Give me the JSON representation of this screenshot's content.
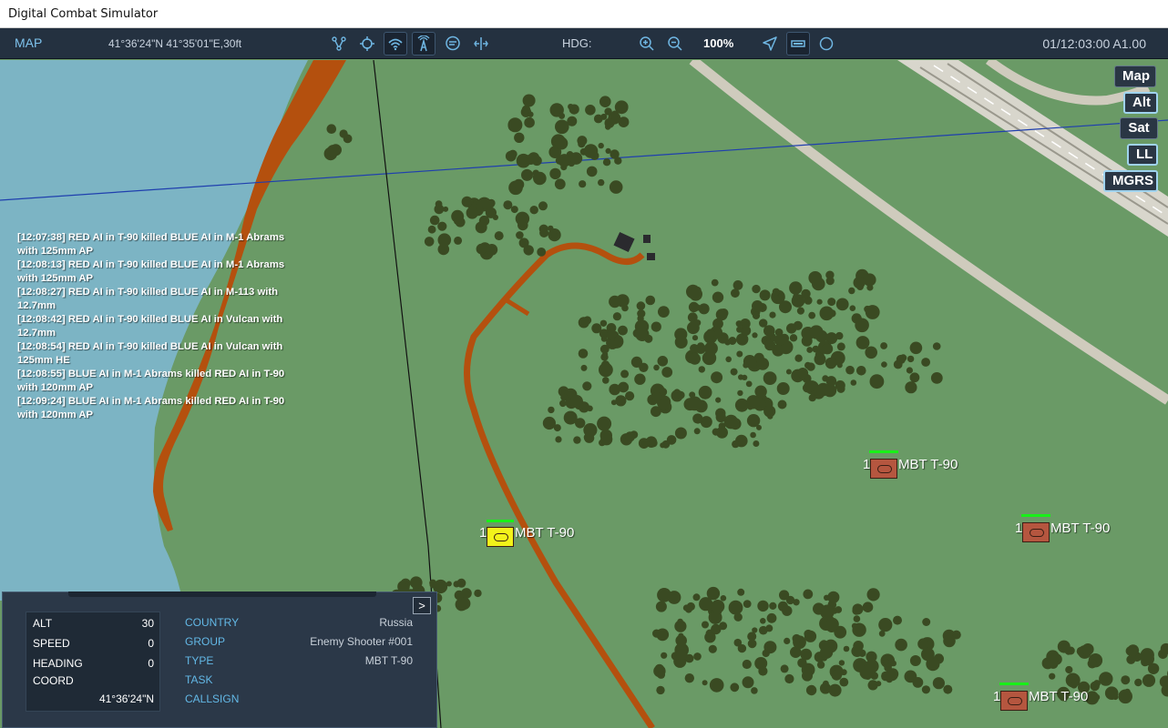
{
  "window": {
    "title": "Digital Combat Simulator"
  },
  "toolbar": {
    "map_label": "MAP",
    "coords": "41°36'24\"N 41°35'01\"E,30ft",
    "hdg_label": "HDG:",
    "zoom": "100%",
    "time": "01/12:03:00 A1.00",
    "icons": [
      "route-icon",
      "target-crosshair-icon",
      "wifi-icon",
      "radio-tower-icon",
      "chat-icon",
      "split-icon",
      "zoom-in-icon",
      "zoom-out-icon",
      "navigate-arrow-icon",
      "toggle-bar-icon",
      "circle-icon"
    ]
  },
  "map_buttons": {
    "map": "Map",
    "alt": "Alt",
    "sat": "Sat",
    "ll": "LL",
    "mgrs": "MGRS"
  },
  "log": [
    "[12:07:38] RED AI in T-90 killed BLUE AI in M-1 Abrams with 125mm AP",
    "[12:08:13] RED AI in T-90 killed BLUE AI in M-1 Abrams with 125mm AP",
    "[12:08:27] RED AI in T-90 killed BLUE AI in M-113 with 12.7mm",
    "[12:08:42] RED AI in T-90 killed BLUE AI in Vulcan with 12.7mm",
    "[12:08:54] RED AI in T-90 killed BLUE AI in Vulcan with 125mm HE",
    "[12:08:55] BLUE AI in M-1 Abrams killed RED AI in T-90 with 120mm AP",
    "[12:09:24] BLUE AI in M-1 Abrams killed RED AI in T-90 with 120mm AP"
  ],
  "units": [
    {
      "count": "1",
      "label": "MBT T-90",
      "selected": true,
      "health": 1.0
    },
    {
      "count": "1",
      "label": "MBT T-90",
      "selected": false,
      "health": 1.0
    },
    {
      "count": "1",
      "label": "MBT T-90",
      "selected": false,
      "health": 1.0
    },
    {
      "count": "1",
      "label": "MBT T-90",
      "selected": false,
      "health": 1.0
    }
  ],
  "panel": {
    "expand_label": ">",
    "stats": {
      "alt_label": "ALT",
      "alt": "30",
      "speed_label": "SPEED",
      "speed": "0",
      "heading_label": "HEADING",
      "heading": "0",
      "coord_label": "COORD",
      "coord": "41°36'24\"N"
    },
    "props": {
      "country_label": "COUNTRY",
      "country": "Russia",
      "group_label": "GROUP",
      "group": "Enemy Shooter #001",
      "type_label": "TYPE",
      "type": "MBT T-90",
      "task_label": "TASK",
      "task": "",
      "callsign_label": "CALLSIGN",
      "callsign": ""
    }
  },
  "colors": {
    "grass": "#6a9a66",
    "water": "#7cb4c4",
    "road": "#b4500e",
    "forest": "#3a4a22",
    "airfield": "#d8d6cc",
    "red_unit": "#b5563f",
    "selected_unit": "#f3f31a",
    "accent": "#63b8e6"
  }
}
